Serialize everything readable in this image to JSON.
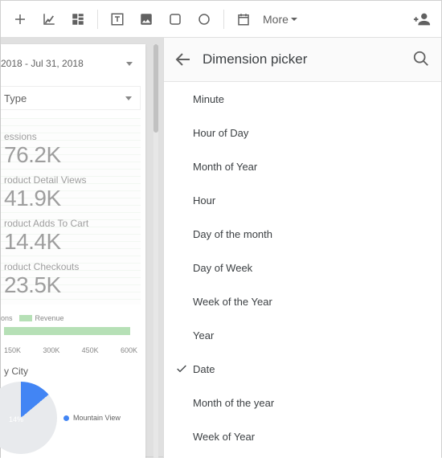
{
  "toolbar": {
    "more_label": "More"
  },
  "canvas": {
    "date_range": "2018 - Jul 31, 2018",
    "type_label": "Type",
    "metrics": [
      {
        "label": "essions",
        "value": "76.2K"
      },
      {
        "label": "roduct Detail Views",
        "value": "41.9K"
      },
      {
        "label": "roduct Adds To Cart",
        "value": "14.4K"
      },
      {
        "label": "roduct Checkouts",
        "value": "23.5K"
      }
    ],
    "legend": {
      "sessions": "ons",
      "revenue": "Revenue"
    },
    "axis": [
      "150K",
      "300K",
      "450K",
      "600K"
    ],
    "subtitle": "y City",
    "pie_pct": "14%",
    "pie_legend": "Mountain View"
  },
  "panel": {
    "title": "Dimension picker",
    "items": [
      {
        "label": "Minute",
        "selected": false
      },
      {
        "label": "Hour of Day",
        "selected": false
      },
      {
        "label": "Month of Year",
        "selected": false
      },
      {
        "label": "Hour",
        "selected": false
      },
      {
        "label": "Day of the month",
        "selected": false
      },
      {
        "label": "Day of Week",
        "selected": false
      },
      {
        "label": "Week of the Year",
        "selected": false
      },
      {
        "label": "Year",
        "selected": false
      },
      {
        "label": "Date",
        "selected": true
      },
      {
        "label": "Month of the year",
        "selected": false
      },
      {
        "label": "Week of Year",
        "selected": false
      }
    ]
  }
}
